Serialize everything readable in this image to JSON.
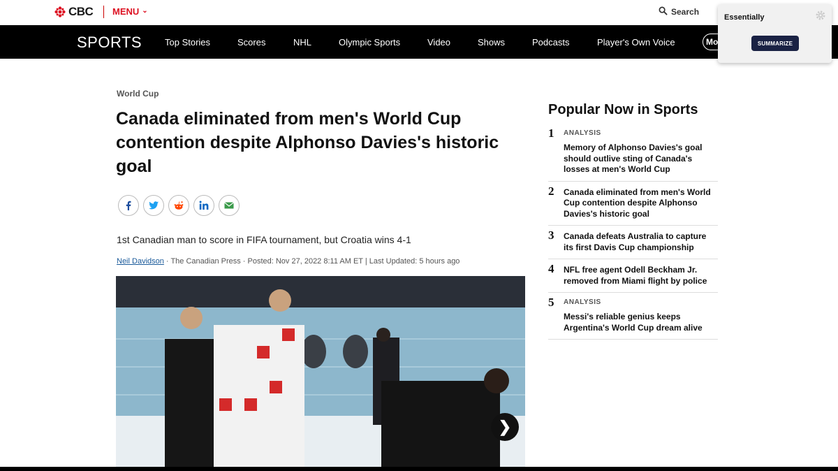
{
  "header": {
    "logo_text": "CBC",
    "menu_label": "MENU",
    "search_label": "Search"
  },
  "nav": {
    "brand": "SPORTS",
    "items": [
      "Top Stories",
      "Scores",
      "NHL",
      "Olympic Sports",
      "Video",
      "Shows",
      "Podcasts",
      "Player's Own Voice"
    ],
    "more_label": "More"
  },
  "extension": {
    "title": "Essentially",
    "button_label": "SUMMARIZE"
  },
  "article": {
    "section": "World Cup",
    "headline": "Canada eliminated from men's World Cup contention despite Alphonso Davies's historic goal",
    "deck": "1st Canadian man to score in FIFA tournament, but Croatia wins 4-1",
    "author": "Neil Davidson",
    "byline_rest": " · The Canadian Press · Posted: Nov 27, 2022 8:11 AM ET | Last Updated: 5 hours ago",
    "share": [
      "facebook",
      "twitter",
      "reddit",
      "linkedin",
      "email"
    ],
    "next_glyph": "❯"
  },
  "sidebar": {
    "title": "Popular Now in Sports",
    "items": [
      {
        "num": "1",
        "kicker": "ANALYSIS",
        "text": "Memory of Alphonso Davies's goal should outlive sting of Canada's losses at men's World Cup"
      },
      {
        "num": "2",
        "kicker": "",
        "text": "Canada eliminated from men's World Cup contention despite Alphonso Davies's historic goal"
      },
      {
        "num": "3",
        "kicker": "",
        "text": "Canada defeats Australia to capture its first Davis Cup championship"
      },
      {
        "num": "4",
        "kicker": "",
        "text": "NFL free agent Odell Beckham Jr. removed from Miami flight by police"
      },
      {
        "num": "5",
        "kicker": "ANALYSIS",
        "text": "Messi's reliable genius keeps Argentina's World Cup dream alive"
      }
    ]
  },
  "colors": {
    "brand_red": "#d12222",
    "nav_bg": "#000000",
    "link_blue": "#1a5a9a",
    "summarize_bg": "#1a2244"
  }
}
